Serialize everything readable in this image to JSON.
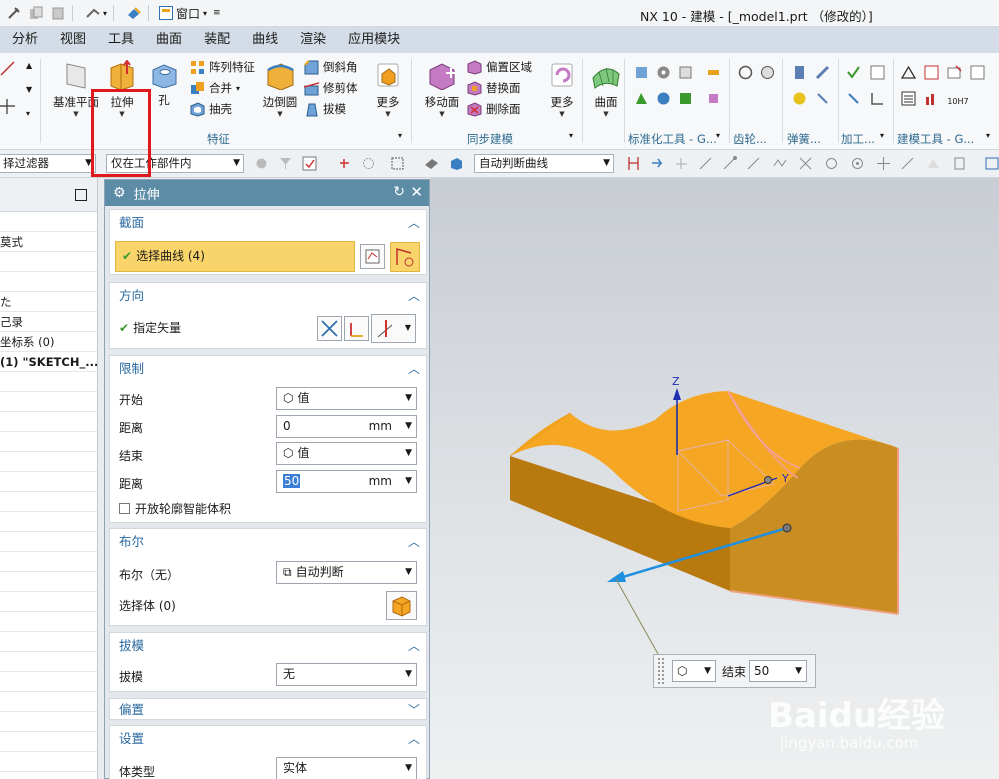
{
  "window": {
    "title": "NX 10 - 建模 - [_model1.prt （修改的）]",
    "window_menu_label": "窗口"
  },
  "menu_tabs": [
    "分析",
    "视图",
    "工具",
    "曲面",
    "装配",
    "曲线",
    "渲染",
    "应用模块"
  ],
  "ribbon": {
    "datum_plane": "基准平面",
    "extrude": "拉伸",
    "hole": "孔",
    "pattern_feature": "阵列特征",
    "unite": "合并",
    "shell": "抽壳",
    "edge_blend": "边倒圆",
    "chamfer": "倒斜角",
    "trim_body": "修剪体",
    "draft": "拔模",
    "more1": "更多",
    "move_face": "移动面",
    "offset_region": "偏置区域",
    "replace_face": "替换面",
    "delete_face": "删除面",
    "more2": "更多",
    "surface": "曲面",
    "group_feature": "特征",
    "group_sync": "同步建模",
    "group_standard": "标准化工具 - G...",
    "group_gear": "齿轮...",
    "group_spring": "弹簧...",
    "group_process": "加工...",
    "group_build": "建模工具 - G...",
    "icon_text_10h7": "10H7"
  },
  "filterbar": {
    "type_filter": "择过滤器",
    "scope": "仅在工作部件内",
    "curve_rule": "自动判断曲线"
  },
  "navigator": {
    "rows": [
      "",
      "莫式",
      "",
      "",
      "た",
      "己录",
      "坐标系 (0)",
      "(1) \"SKETCH_...",
      "",
      "",
      "",
      "",
      "",
      "",
      "",
      "",
      "",
      "",
      "",
      "",
      "",
      "",
      "",
      "",
      "",
      "",
      "",
      ""
    ]
  },
  "dialog": {
    "title": "拉伸",
    "section": {
      "header": "截面",
      "select_curve": "选择曲线 (4)"
    },
    "direction": {
      "header": "方向",
      "specify_vector": "指定矢量"
    },
    "limits": {
      "header": "限制",
      "start_label": "开始",
      "start_value": "值",
      "distance1_label": "距离",
      "distance1_value": "0",
      "distance1_unit": "mm",
      "end_label": "结束",
      "end_value": "值",
      "distance2_label": "距离",
      "distance2_value": "50",
      "distance2_unit": "mm",
      "open_profile": "开放轮廓智能体积"
    },
    "boolean": {
      "header": "布尔",
      "boolean_label": "布尔（无）",
      "boolean_value": "自动判断",
      "select_body": "选择体 (0)"
    },
    "draft": {
      "header": "拔模",
      "draft_label": "拔模",
      "draft_value": "无"
    },
    "offset": {
      "header": "偏置"
    },
    "settings": {
      "header": "设置",
      "body_type_label": "体类型",
      "body_type_value": "实体"
    }
  },
  "viewport": {
    "axis_z": "Z",
    "axis_y": "Y",
    "tooltip_label": "结束",
    "tooltip_value": "50",
    "watermark": "Baidu经验",
    "watermark_url": "jingyan.baidu.com"
  },
  "colors": {
    "accent_red": "#e1191c",
    "dialog_title": "#5d8da6",
    "selection_yellow": "#f9d46a",
    "solid_orange": "#f5a623",
    "vector_blue": "#1f8fe0"
  }
}
